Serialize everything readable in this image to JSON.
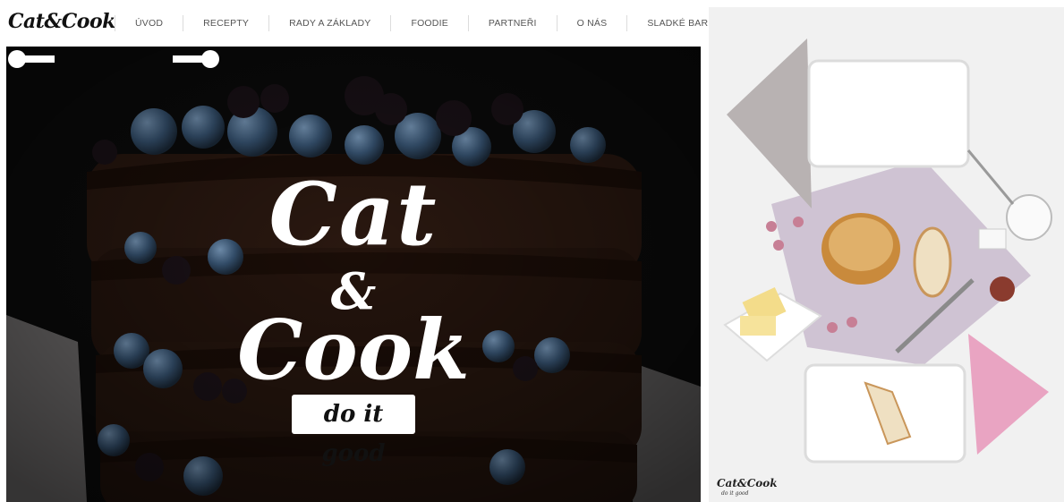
{
  "header": {
    "logo": "Cat&Cook",
    "nav": [
      {
        "label": "ÚVOD"
      },
      {
        "label": "RECEPTY"
      },
      {
        "label": "RADY A ZÁKLADY"
      },
      {
        "label": "FOODIE"
      },
      {
        "label": "PARTNEŘI"
      },
      {
        "label": "O NÁS"
      },
      {
        "label": "SLADKÉ BAR"
      }
    ]
  },
  "hero": {
    "title_line1": "Cat",
    "title_amp": "&",
    "title_line2": "Cook",
    "tagline": "do it good"
  },
  "photo": {
    "watermark_logo": "Cat&Cook",
    "watermark_tagline": "do it good"
  },
  "colors": {
    "hero_background": "#0b0b0b",
    "cake": "#2a1810",
    "blueberry": "#3a5878",
    "napkin_pink": "#e9a4c2",
    "napkin_grey": "#b8b2b2"
  }
}
